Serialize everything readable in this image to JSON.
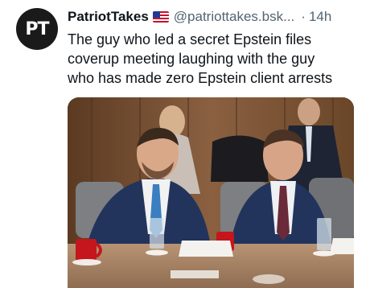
{
  "author": {
    "avatar_text": "PT",
    "display_name": "PatriotTakes",
    "flag_icon": "us-flag-icon",
    "handle": "@patriottakes.bsk...",
    "separator": "·",
    "timestamp": "14h"
  },
  "post": {
    "text_lines": [
      "The guy who led a secret Epstein files",
      "coverup meeting laughing with the guy",
      "who has made zero Epstein client arrests"
    ]
  },
  "media": {
    "description_icon": "photo-icon",
    "accent_colors": {
      "wood_panel": "#7a5233",
      "table": "#a98567",
      "suit": "#22345c",
      "mug": "#c4161c"
    }
  }
}
